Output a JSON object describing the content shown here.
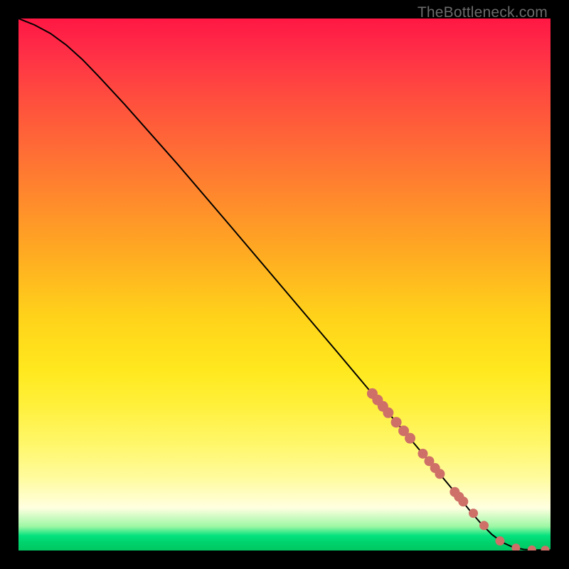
{
  "attribution": "TheBottleneck.com",
  "colors": {
    "marker": "#ce6f68",
    "line": "#000000",
    "frame_bg_top": "#ff1744",
    "frame_bg_bottom": "#00c862",
    "page_bg": "#000000"
  },
  "chart_data": {
    "type": "line",
    "title": "",
    "xlabel": "",
    "ylabel": "",
    "xlim": [
      0,
      100
    ],
    "ylim": [
      0,
      100
    ],
    "series": [
      {
        "name": "bottleneck-curve",
        "x": [
          0,
          3,
          6,
          9,
          12,
          15,
          20,
          30,
          40,
          50,
          60,
          70,
          78,
          83,
          85,
          87,
          89,
          91,
          93,
          95,
          97,
          100
        ],
        "y": [
          100,
          98.8,
          97.2,
          95.0,
          92.3,
          89.2,
          83.8,
          72.5,
          60.8,
          49.0,
          37.2,
          25.3,
          15.8,
          9.8,
          7.3,
          5.0,
          3.0,
          1.5,
          0.6,
          0.2,
          0.1,
          0.1
        ]
      }
    ],
    "scatter": [
      {
        "name": "highlighted-region",
        "x": [
          66.5,
          67.5,
          68.5,
          69.5,
          71.0,
          72.4,
          73.6,
          76.0,
          77.2,
          78.3,
          79.2,
          82.0,
          82.8,
          83.6,
          85.5,
          87.5,
          90.5,
          93.5,
          96.5,
          99.0
        ],
        "y": [
          29.5,
          28.3,
          27.1,
          25.9,
          24.1,
          22.5,
          21.1,
          18.2,
          16.8,
          15.5,
          14.4,
          11.0,
          10.1,
          9.2,
          7.0,
          4.7,
          1.8,
          0.5,
          0.15,
          0.1
        ],
        "sz": [
          7.5,
          7.5,
          7.5,
          7.5,
          7.5,
          7.5,
          7.5,
          7.0,
          7.0,
          7.0,
          7.0,
          7.0,
          7.0,
          7.0,
          6.5,
          6.5,
          6.5,
          6.0,
          6.0,
          6.0
        ]
      }
    ]
  }
}
